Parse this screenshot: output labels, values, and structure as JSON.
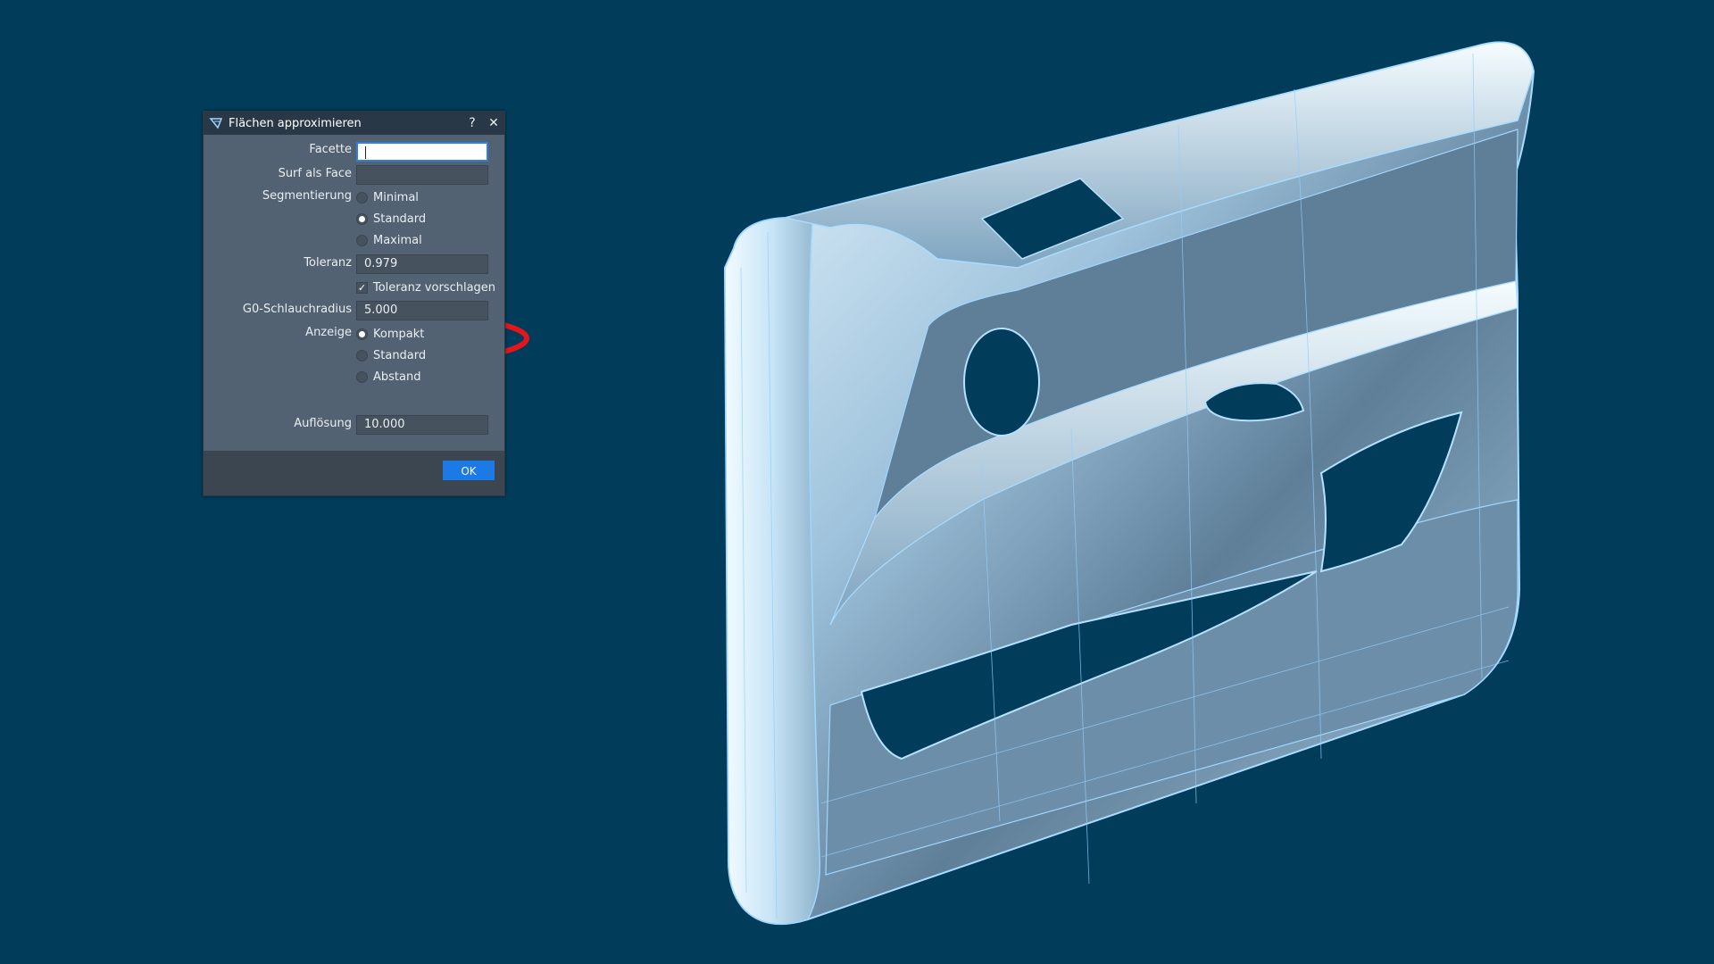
{
  "colors": {
    "background": "#013d5b",
    "dialog_body": "#526272",
    "dialog_titlebar": "#283846",
    "accent": "#1c7ae6",
    "annotation": "#e3171b",
    "model_light": "#dff2ff",
    "model_edge": "#8fd0ff"
  },
  "dialog": {
    "icon": "approximate-surfaces-icon",
    "title": "Flächen approximieren",
    "help_label": "?",
    "close_label": "✕",
    "facette_label": "Facette",
    "facette_value": "",
    "surf_label": "Surf als Face",
    "surf_value": "",
    "segmentierung_label": "Segmentierung",
    "segmentierung_options": [
      "Minimal",
      "Standard",
      "Maximal"
    ],
    "segmentierung_selected": "Standard",
    "toleranz_label": "Toleranz",
    "toleranz_value": "0.979",
    "toleranz_vorschlagen_label": "Toleranz vorschlagen",
    "toleranz_vorschlagen_checked": true,
    "schlauchradius_label": "G0-Schlauchradius",
    "schlauchradius_value": "5.000",
    "anzeige_label": "Anzeige",
    "anzeige_options": [
      "Kompakt",
      "Standard",
      "Abstand"
    ],
    "anzeige_selected": "Kompakt",
    "aufloesung_label": "Auflösung",
    "aufloesung_value": "10.000",
    "ok_label": "OK"
  },
  "viewport": {
    "model": "car-door-panel-surface-model"
  }
}
